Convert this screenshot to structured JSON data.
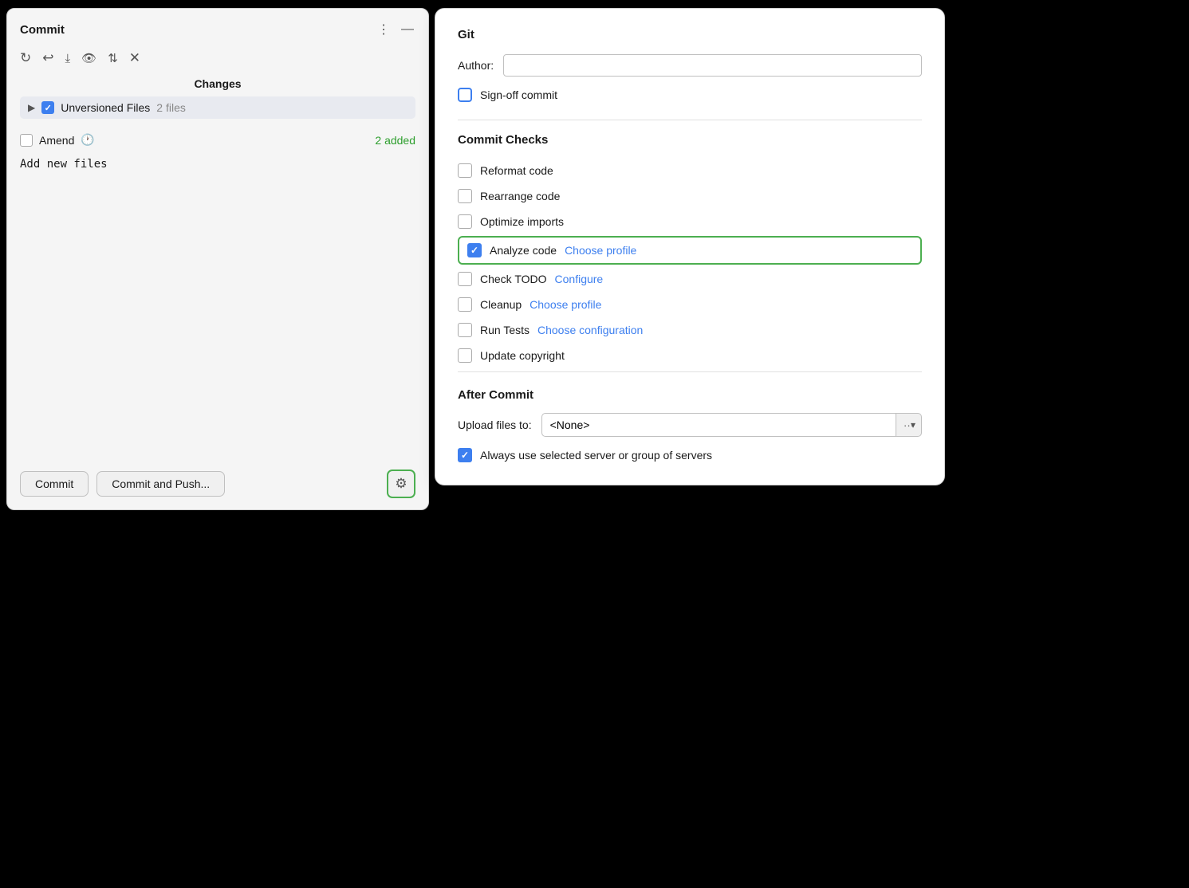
{
  "commitPanel": {
    "title": "Commit",
    "toolbar": {
      "icons": [
        "refresh",
        "undo",
        "download",
        "eye",
        "up-down",
        "close"
      ]
    },
    "changes": {
      "label": "Changes",
      "fileRow": {
        "name": "Unversioned Files",
        "count": "2 files"
      }
    },
    "amend": {
      "label": "Amend",
      "addedText": "2 added"
    },
    "message": "Add new files",
    "buttons": {
      "commit": "Commit",
      "commitAndPush": "Commit and Push..."
    }
  },
  "gitPanel": {
    "title": "Git",
    "author": {
      "label": "Author:",
      "placeholder": ""
    },
    "signoff": {
      "label": "Sign-off commit"
    },
    "commitChecks": {
      "label": "Commit Checks",
      "items": [
        {
          "id": "reformat",
          "label": "Reformat code",
          "checked": false,
          "link": null
        },
        {
          "id": "rearrange",
          "label": "Rearrange code",
          "checked": false,
          "link": null
        },
        {
          "id": "optimize",
          "label": "Optimize imports",
          "checked": false,
          "link": null
        },
        {
          "id": "analyze",
          "label": "Analyze code",
          "checked": true,
          "link": "Choose profile",
          "highlighted": true
        },
        {
          "id": "todo",
          "label": "Check TODO",
          "checked": false,
          "link": "Configure"
        },
        {
          "id": "cleanup",
          "label": "Cleanup",
          "checked": false,
          "link": "Choose profile"
        },
        {
          "id": "runtests",
          "label": "Run Tests",
          "checked": false,
          "link": "Choose configuration"
        },
        {
          "id": "copyright",
          "label": "Update copyright",
          "checked": false,
          "link": null
        }
      ]
    },
    "afterCommit": {
      "label": "After Commit",
      "uploadLabel": "Upload files to:",
      "uploadValue": "<None>",
      "alwaysUse": {
        "label": "Always use selected server or group of servers",
        "checked": true
      }
    }
  }
}
